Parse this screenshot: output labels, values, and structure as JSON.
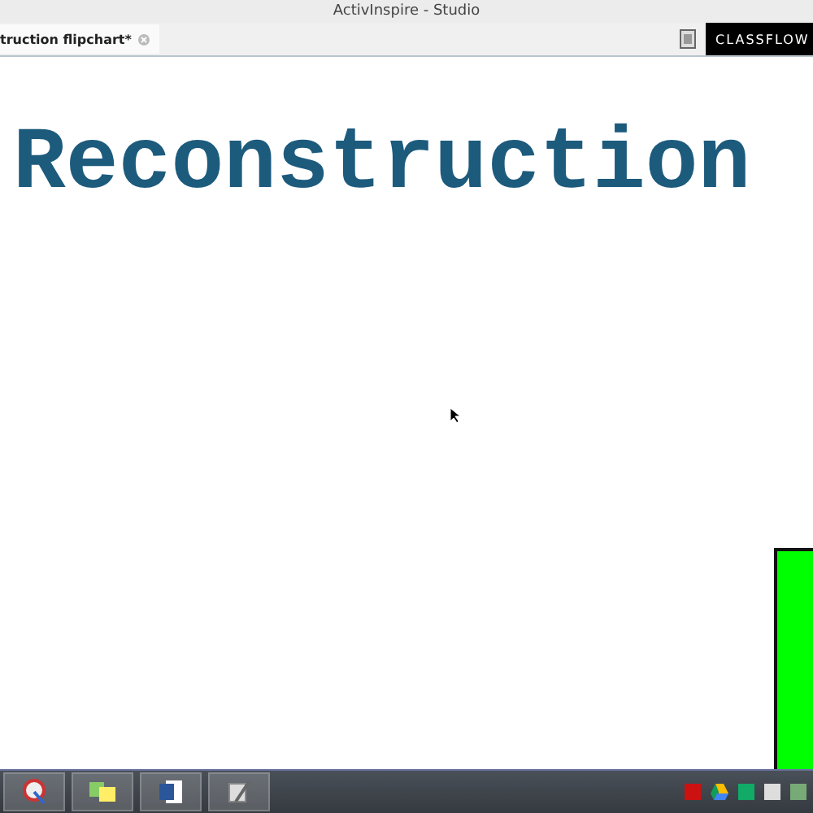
{
  "window": {
    "title": "ActivInspire - Studio"
  },
  "tabs": [
    {
      "label": "truction flipchart*",
      "selected": true
    }
  ],
  "brand": {
    "label": "CLASSFLOW"
  },
  "canvas": {
    "heading": "Reconstruction"
  }
}
